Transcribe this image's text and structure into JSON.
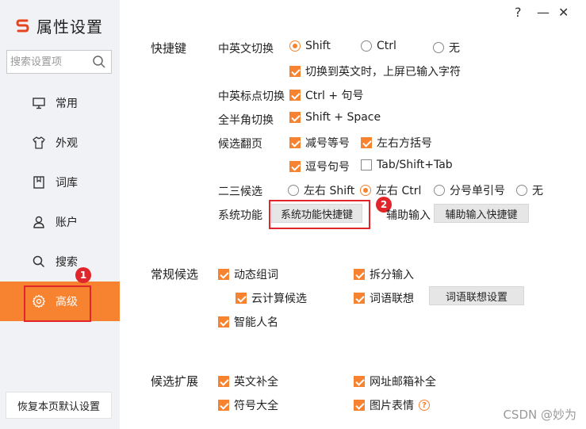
{
  "window": {
    "help": "?",
    "minimize": "—",
    "close": "✕"
  },
  "sidebar": {
    "brand_logo": "S",
    "title": "属性设置",
    "search_placeholder": "搜索设置项",
    "items": [
      {
        "label": "常用",
        "icon": "monitor-icon"
      },
      {
        "label": "外观",
        "icon": "shirt-icon"
      },
      {
        "label": "词库",
        "icon": "book-icon"
      },
      {
        "label": "账户",
        "icon": "user-icon"
      },
      {
        "label": "搜索",
        "icon": "search-icon"
      },
      {
        "label": "高级",
        "icon": "gear-icon",
        "active": true
      }
    ],
    "reset_label": "恢复本页默认设置"
  },
  "badges": {
    "one": "1",
    "two": "2"
  },
  "hotkeys": {
    "section_title": "快捷键",
    "cn_en_switch": {
      "label": "中英文切换",
      "opt1": "Shift",
      "opt2": "Ctrl",
      "opt3": "无",
      "selected": "Shift"
    },
    "switch_en_commit": "切换到英文时，上屏已输入字符",
    "punct_switch": {
      "label": "中英标点切换",
      "opt": "Ctrl + 句号"
    },
    "width_switch": {
      "label": "全半角切换",
      "opt": "Shift + Space"
    },
    "page_turn": {
      "label": "候选翻页",
      "opt1": "减号等号",
      "opt2": "左右方括号",
      "opt3": "逗号句号",
      "opt4": "Tab/Shift+Tab"
    },
    "second_third": {
      "label": "二三候选",
      "opt1": "左右 Shift",
      "opt2": "左右 Ctrl",
      "opt3": "分号单引号",
      "opt4": "无",
      "selected": "左右 Ctrl"
    },
    "system": {
      "label": "系统功能",
      "button": "系统功能快捷键"
    },
    "assist": {
      "label": "辅助输入",
      "button": "辅助输入快捷键"
    }
  },
  "general_candidates": {
    "section_title": "常规候选",
    "dynamic": "动态组词",
    "split": "拆分输入",
    "cloud": "云计算候选",
    "assoc": "词语联想",
    "assoc_button": "词语联想设置",
    "name": "智能人名"
  },
  "candidate_ext": {
    "section_title": "候选扩展",
    "en_complete": "英文补全",
    "url_complete": "网址邮箱补全",
    "symbols": "符号大全",
    "emoji": "图片表情"
  },
  "watermark": "CSDN @妙为",
  "colors": {
    "accent": "#f7822f",
    "highlight_box": "#e0262b",
    "sidebar_bg": "#f1f2f5"
  }
}
